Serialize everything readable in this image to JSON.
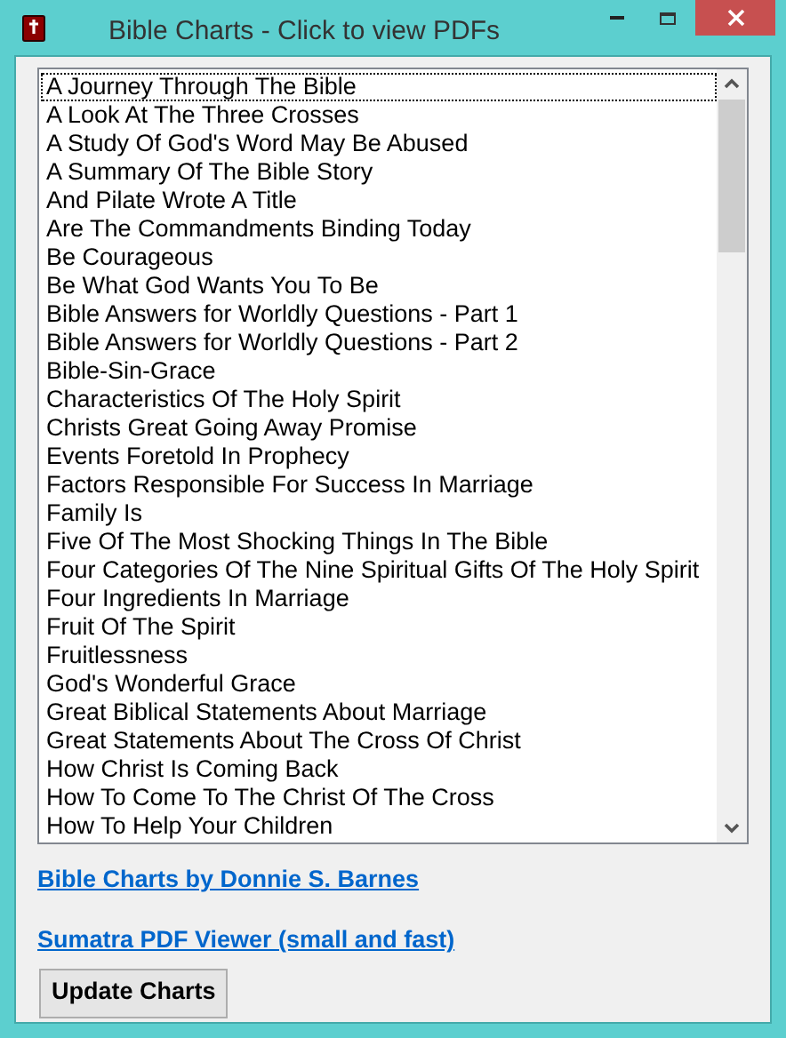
{
  "window": {
    "title": "Bible Charts - Click to view PDFs"
  },
  "charts": [
    {
      "label": "A Journey Through The Bible",
      "focused": true
    },
    {
      "label": "A Look At The Three Crosses",
      "focused": false
    },
    {
      "label": "A Study Of God's Word May Be Abused",
      "focused": false
    },
    {
      "label": "A Summary Of The Bible Story",
      "focused": false
    },
    {
      "label": "And Pilate Wrote A Title",
      "focused": false
    },
    {
      "label": "Are The Commandments Binding Today",
      "focused": false
    },
    {
      "label": "Be Courageous",
      "focused": false
    },
    {
      "label": "Be What God Wants You To Be",
      "focused": false
    },
    {
      "label": "Bible Answers for Worldly Questions - Part 1",
      "focused": false
    },
    {
      "label": "Bible Answers for Worldly Questions - Part 2",
      "focused": false
    },
    {
      "label": "Bible-Sin-Grace",
      "focused": false
    },
    {
      "label": "Characteristics Of The Holy Spirit",
      "focused": false
    },
    {
      "label": "Christs Great Going Away Promise",
      "focused": false
    },
    {
      "label": "Events Foretold In Prophecy",
      "focused": false
    },
    {
      "label": "Factors Responsible For Success In Marriage",
      "focused": false
    },
    {
      "label": "Family Is",
      "focused": false
    },
    {
      "label": "Five Of The Most Shocking Things In The Bible",
      "focused": false
    },
    {
      "label": "Four Categories Of The Nine Spiritual Gifts Of The Holy Spirit",
      "focused": false
    },
    {
      "label": "Four Ingredients In Marriage",
      "focused": false
    },
    {
      "label": "Fruit Of The Spirit",
      "focused": false
    },
    {
      "label": "Fruitlessness",
      "focused": false
    },
    {
      "label": "God's Wonderful Grace",
      "focused": false
    },
    {
      "label": "Great Biblical Statements About Marriage",
      "focused": false
    },
    {
      "label": "Great Statements About The Cross Of Christ",
      "focused": false
    },
    {
      "label": "How Christ Is Coming Back",
      "focused": false
    },
    {
      "label": "How To Come To The Christ Of The Cross",
      "focused": false
    },
    {
      "label": "How To Help Your Children",
      "focused": false
    }
  ],
  "links": [
    "Bible Charts by Donnie S. Barnes",
    "Sumatra PDF Viewer (small and fast)"
  ],
  "buttons": [
    "Update Charts"
  ]
}
